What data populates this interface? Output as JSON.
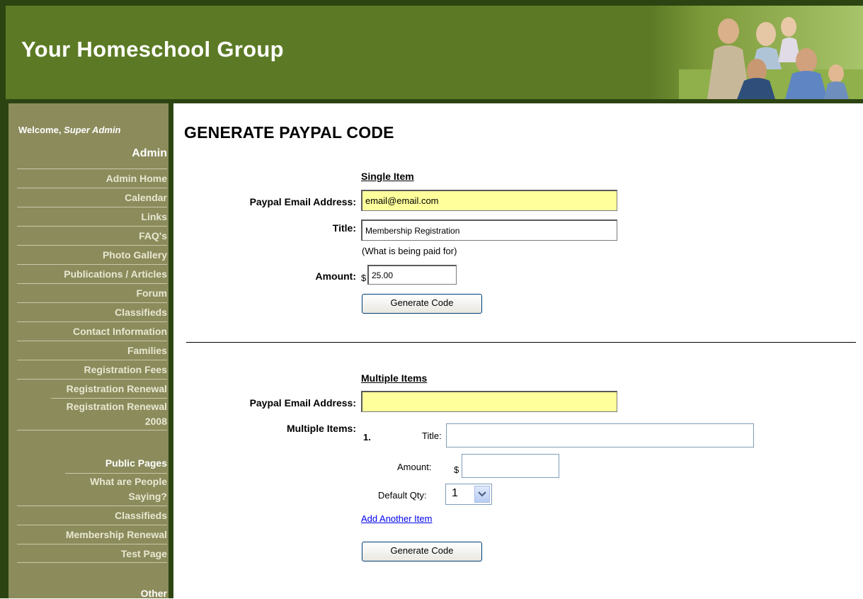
{
  "header": {
    "site_title": "Your Homeschool Group"
  },
  "sidebar": {
    "welcome_prefix": "Welcome,",
    "welcome_user": "Super Admin",
    "admin_heading": "Admin",
    "admin_items": [
      {
        "label": "Admin Home"
      },
      {
        "label": "Calendar"
      },
      {
        "label": "Links"
      },
      {
        "label": "FAQ's"
      },
      {
        "label": "Photo Gallery"
      },
      {
        "label": "Publications / Articles"
      },
      {
        "label": "Forum"
      },
      {
        "label": "Classifieds"
      },
      {
        "label": "Contact Information"
      },
      {
        "label": "Families"
      },
      {
        "label": "Registration Fees"
      },
      {
        "label": "Registration Renewal"
      },
      {
        "label": "Registration Renewal 2008"
      }
    ],
    "public_heading": "Public Pages",
    "public_items": [
      {
        "label": "What are People Saying?"
      },
      {
        "label": "Classifieds"
      },
      {
        "label": "Membership Renewal"
      },
      {
        "label": "Test Page"
      }
    ],
    "other_heading": "Other"
  },
  "main": {
    "page_title": "GENERATE PAYPAL CODE",
    "single": {
      "heading": "Single Item",
      "email_label": "Paypal Email Address:",
      "email_value": "email@email.com",
      "title_label": "Title:",
      "title_value": "Membership Registration",
      "title_note": "(What is being paid for)",
      "amount_label": "Amount:",
      "currency": "$",
      "amount_value": "25.00",
      "button": "Generate Code"
    },
    "multiple": {
      "heading": "Multiple Items",
      "email_label": "Paypal Email Address:",
      "email_value": "",
      "items_label": "Multiple Items:",
      "item_number": "1.",
      "item_title_label": "Title:",
      "item_title_value": "",
      "item_amount_label": "Amount:",
      "currency": "$",
      "item_amount_value": "",
      "qty_label": "Default Qty:",
      "qty_value": "1",
      "add_link": "Add Another Item",
      "button": "Generate Code"
    }
  },
  "colors": {
    "header_bg": "#5c7a25",
    "frame": "#2c4412",
    "sidebar_bg": "#8b8b5c",
    "highlight_input": "#ffff9c"
  }
}
